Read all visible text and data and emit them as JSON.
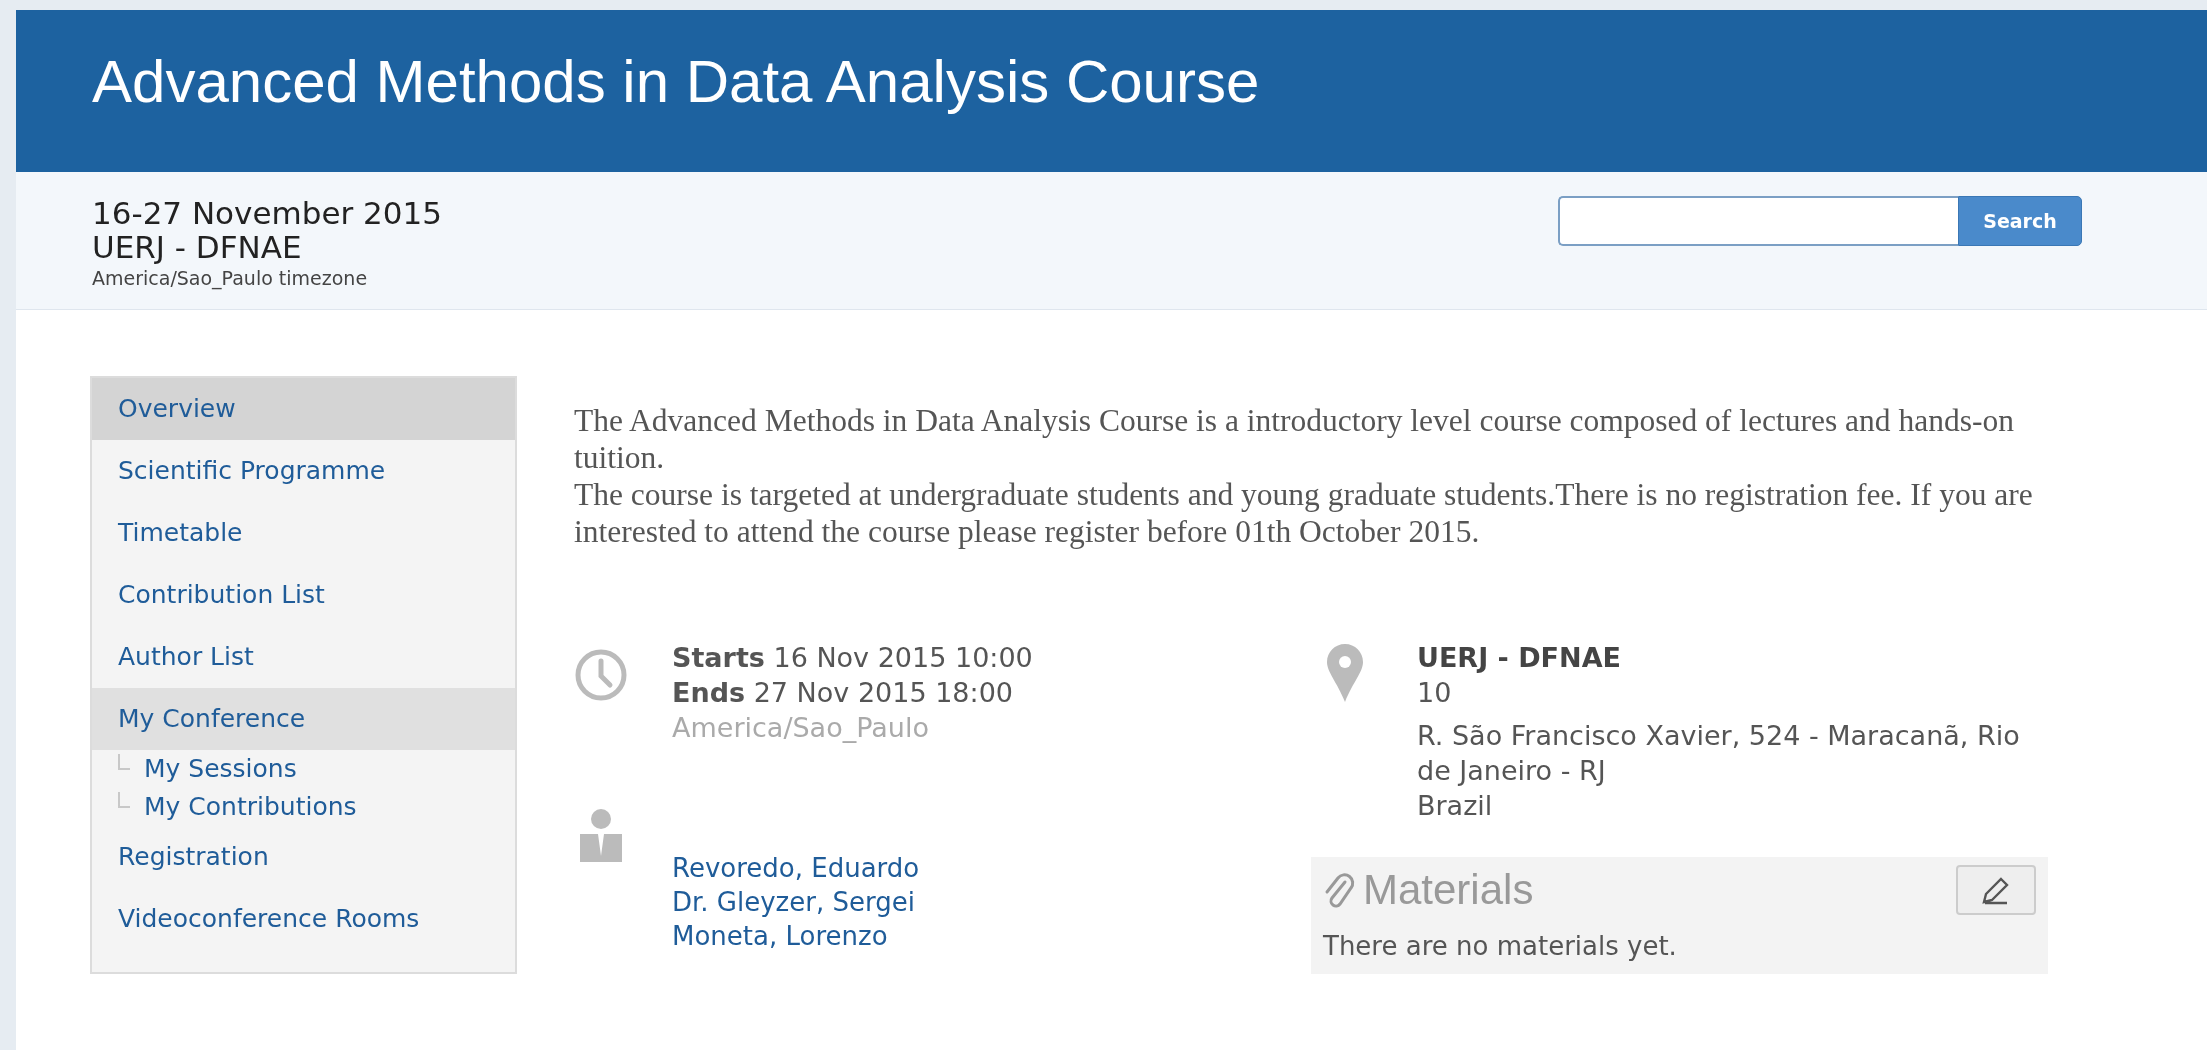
{
  "header": {
    "title": "Advanced Methods in Data Analysis Course"
  },
  "subheader": {
    "dates": "16-27 November 2015",
    "venue": "UERJ - DFNAE",
    "timezone": "America/Sao_Paulo timezone"
  },
  "search": {
    "button": "Search"
  },
  "sidebar": {
    "items": [
      {
        "label": "Overview",
        "selected": true
      },
      {
        "label": "Scientific Programme",
        "selected": false
      },
      {
        "label": "Timetable",
        "selected": false
      },
      {
        "label": "Contribution List",
        "selected": false
      },
      {
        "label": "Author List",
        "selected": false
      },
      {
        "label": "My Conference",
        "selected": false,
        "expanded": true,
        "children": [
          {
            "label": "My Sessions",
            "selected": false
          },
          {
            "label": "My Contributions",
            "selected": false
          }
        ]
      },
      {
        "label": "Registration",
        "selected": false
      },
      {
        "label": "Videoconference Rooms",
        "selected": false
      }
    ]
  },
  "description": "The Advanced Methods in Data Analysis Course is a introductory level course composed of lectures and hands-on tuition.\nThe course is targeted at undergraduate students and young graduate students.There is no registration fee. If you are interested to attend the course please register before 01th October 2015.",
  "time": {
    "starts": "**Starts** 16 Nov 2015 10:00",
    "ends": "**Ends** 27 Nov 2015 18:00",
    "timezone": "America/Sao_Paulo"
  },
  "location": {
    "name": "UERJ - DFNAE",
    "room": "10",
    "address": "R. São Francisco Xavier, 524 - Maracanã, Rio de Janeiro - RJ\nBrazil"
  },
  "chairs": [
    "Revoredo, Eduardo",
    "Dr. Gleyzer, Sergei",
    "Moneta, Lorenzo"
  ],
  "materials": {
    "title": "Materials",
    "empty_text": "There are no materials yet."
  }
}
